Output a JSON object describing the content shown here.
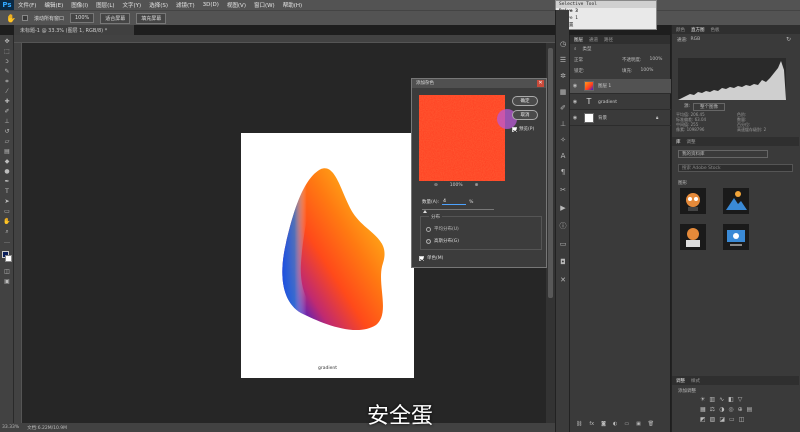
{
  "menu": {
    "logo": "Ps",
    "items": [
      "文件(F)",
      "编辑(E)",
      "图像(I)",
      "图层(L)",
      "文字(Y)",
      "选择(S)",
      "滤镜(T)",
      "3D(D)",
      "视图(V)",
      "窗口(W)",
      "帮助(H)"
    ]
  },
  "options_bar": {
    "scroll_all": "滚动所有窗口",
    "zoom": "100%",
    "fit_screen": "适合屏幕",
    "fill_screen": "填充屏幕"
  },
  "document": {
    "tab": "未标题-1 @ 33.3% (图层 1, RGB/8) *",
    "caption": "gradient"
  },
  "status": {
    "zoom": "33.33%",
    "doc_size": "文档:6.22M/10.9M"
  },
  "subtitle": "安全蛋",
  "dialog": {
    "title": "添加杂色",
    "ok": "确定",
    "cancel": "取消",
    "preview_label": "预览(P)",
    "zoom": "100%",
    "amount_label": "数量(A):",
    "amount_value": "4",
    "amount_unit": "%",
    "distribution_label": "分布",
    "uniform": "平均分布(U)",
    "gaussian": "高斯分布(G)",
    "mono": "单色(M)"
  },
  "selective_tool": {
    "title": "Selective Tool",
    "line1": "Drive 3",
    "line2": "Drive 1",
    "line3": "→ 位置"
  },
  "layers": {
    "tabs": [
      "图层",
      "通道",
      "路径"
    ],
    "kind": "类型",
    "blend": "正常",
    "opacity_label": "不透明度:",
    "opacity": "100%",
    "lock_label": "锁定:",
    "fill_label": "填充:",
    "fill": "100%",
    "items": [
      {
        "name": "图层 1"
      },
      {
        "name": "gradient"
      },
      {
        "name": "背景"
      }
    ]
  },
  "right_panel": {
    "tabs": [
      "颜色",
      "直方图",
      "色板"
    ],
    "channel_label": "通道:",
    "channel": "RGB",
    "source_label": "源:",
    "source": "整个图像",
    "stats": [
      "平均值: 206.45",
      "标准偏差: 63.04",
      "中间值: 255",
      "像素: 1098796"
    ],
    "stats2": [
      "色阶:",
      "数量:",
      "百分位:",
      "高速缓存级别: 2"
    ],
    "libraries_tabs": [
      "库",
      "调整"
    ],
    "library_name": "我的资料库",
    "library_search": "搜索 Adobe Stock",
    "graphics_label": "图形",
    "adjust_tabs": [
      "调整",
      "样式"
    ],
    "adjust_add": "添加调整"
  },
  "colors": {
    "bg": "#1e1e1e",
    "panel": "#3a3a3a",
    "preview_orange": "#ff3d20"
  }
}
